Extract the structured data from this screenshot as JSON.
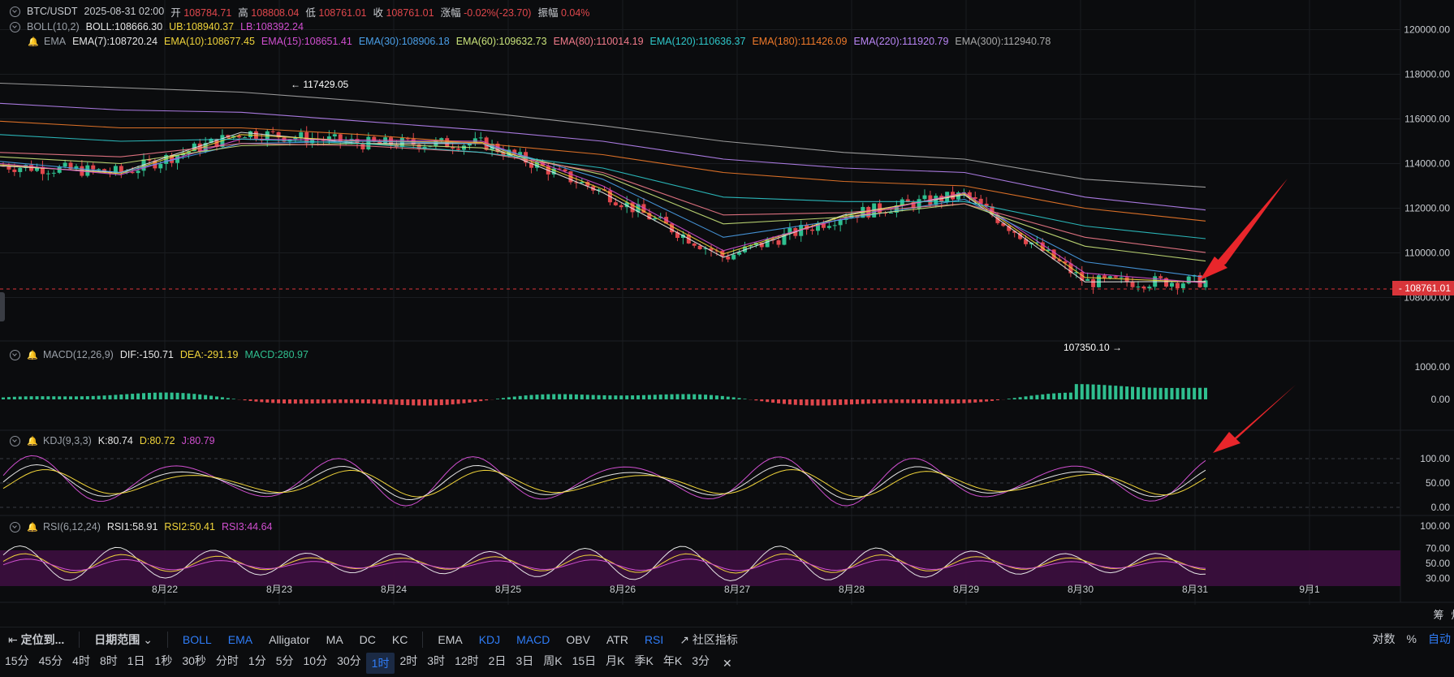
{
  "header": {
    "symbol_line": {
      "symbol": "BTC/USDT",
      "datetime": "2025-08-31 02:00",
      "open_label": "开",
      "open": "108784.71",
      "high_label": "高",
      "high": "108808.04",
      "low_label": "低",
      "low": "108761.01",
      "close_label": "收",
      "close": "108761.01",
      "change_label": "涨幅",
      "change": "-0.02%(-23.70)",
      "amplitude_label": "振幅",
      "amplitude": "0.04%"
    },
    "boll_line": {
      "name": "BOLL(10,2)",
      "mid": "BOLL:108666.30",
      "ub": "UB:108940.37",
      "lb": "LB:108392.24"
    },
    "ema_line": {
      "name": "EMA",
      "items": [
        {
          "text": "EMA(7):108720.24",
          "color": "#e6e6e6"
        },
        {
          "text": "EMA(10):108677.45",
          "color": "#f0d43a"
        },
        {
          "text": "EMA(15):108651.41",
          "color": "#d04fd0"
        },
        {
          "text": "EMA(30):108906.18",
          "color": "#4a9fe8"
        },
        {
          "text": "EMA(60):109632.73",
          "color": "#c9e37a"
        },
        {
          "text": "EMA(80):110014.19",
          "color": "#f07a8a"
        },
        {
          "text": "EMA(120):110636.37",
          "color": "#2ec7c9"
        },
        {
          "text": "EMA(180):111426.09",
          "color": "#f07a2a"
        },
        {
          "text": "EMA(220):111920.79",
          "color": "#b985f5"
        },
        {
          "text": "EMA(300):112940.78",
          "color": "#a8a8a8"
        }
      ]
    },
    "macd_line": {
      "name": "MACD(12,26,9)",
      "dif": "DIF:-150.71",
      "dea": "DEA:-291.19",
      "macd": "MACD:280.97"
    },
    "kdj_line": {
      "name": "KDJ(9,3,3)",
      "k": "K:80.74",
      "d": "D:80.72",
      "j": "J:80.79"
    },
    "rsi_line": {
      "name": "RSI(6,12,24)",
      "r1": "RSI1:58.91",
      "r2": "RSI2:50.41",
      "r3": "RSI3:44.64"
    }
  },
  "price_tag": "108761.01",
  "annotations": {
    "high_marker": "117429.05",
    "low_marker": "107350.10"
  },
  "chart_data": {
    "type": "line",
    "candlestick": true,
    "x": [
      "8月22",
      "8月23",
      "8月24",
      "8月25",
      "8月26",
      "8月27",
      "8月28",
      "8月29",
      "8月30",
      "8月31",
      "9月1"
    ],
    "price_ticks": [
      108000,
      110000,
      112000,
      114000,
      116000,
      118000,
      120000
    ],
    "price_range": [
      106600,
      120600
    ],
    "current_price": 108761.01,
    "series": [
      {
        "name": "EMA(7)",
        "color": "#e6e6e6",
        "values": [
          113900,
          113600,
          115400,
          114900,
          114900,
          112700,
          109800,
          111700,
          112600,
          108700,
          108720
        ]
      },
      {
        "name": "EMA(10)",
        "color": "#f0d43a",
        "values": [
          113950,
          113550,
          115300,
          115000,
          114950,
          112850,
          109950,
          111650,
          112650,
          108900,
          108677
        ]
      },
      {
        "name": "EMA(15)",
        "color": "#d04fd0",
        "values": [
          114000,
          113500,
          115100,
          115050,
          115000,
          113000,
          110100,
          111550,
          112700,
          109100,
          108651
        ]
      },
      {
        "name": "EMA(30)",
        "color": "#4a9fe8",
        "values": [
          114100,
          113600,
          114900,
          115000,
          114900,
          113300,
          110700,
          111500,
          112400,
          109600,
          108906
        ]
      },
      {
        "name": "EMA(60)",
        "color": "#c9e37a",
        "values": [
          114300,
          114000,
          114800,
          114900,
          114700,
          113500,
          111300,
          111600,
          112200,
          110300,
          109633
        ]
      },
      {
        "name": "EMA(80)",
        "color": "#f07a8a",
        "values": [
          114500,
          114300,
          114900,
          114800,
          114500,
          113600,
          111700,
          111800,
          112200,
          110700,
          110014
        ]
      },
      {
        "name": "EMA(120)",
        "color": "#2ec7c9",
        "values": [
          115300,
          115000,
          115100,
          114900,
          114500,
          113800,
          112500,
          112300,
          112300,
          111200,
          110636
        ]
      },
      {
        "name": "EMA(180)",
        "color": "#f07a2a",
        "values": [
          115900,
          115600,
          115600,
          115300,
          114900,
          114400,
          113600,
          113200,
          113000,
          112000,
          111426
        ]
      },
      {
        "name": "EMA(220)",
        "color": "#b985f5",
        "values": [
          116700,
          116400,
          116300,
          115900,
          115500,
          115000,
          114200,
          113800,
          113600,
          112500,
          111921
        ]
      },
      {
        "name": "EMA(300)",
        "color": "#a8a8a8",
        "values": [
          117600,
          117400,
          117200,
          116800,
          116300,
          115700,
          115000,
          114500,
          114200,
          113300,
          112941
        ]
      }
    ],
    "high": 117429.05,
    "low": 107350.1,
    "macd": {
      "ticks": [
        1000,
        0
      ],
      "dif": -150.71,
      "dea": -291.19,
      "macd": 280.97
    },
    "kdj": {
      "ticks": [
        100,
        50,
        0
      ],
      "k": 80.74,
      "d": 80.72,
      "j": 80.79
    },
    "rsi": {
      "ticks": [
        100,
        70,
        50,
        30
      ],
      "rsi1": 58.91,
      "rsi2": 50.41,
      "rsi3": 44.64
    }
  },
  "toolbar1": {
    "locate": "定位到...",
    "date_range": "日期范围",
    "main_indicators": [
      "BOLL",
      "EMA",
      "Alligator",
      "MA",
      "DC",
      "KC"
    ],
    "sub_indicators": [
      "EMA",
      "KDJ",
      "MACD",
      "OBV",
      "ATR",
      "RSI"
    ],
    "community": "社区指标",
    "right": [
      "对数",
      "%",
      "自动"
    ]
  },
  "toolbar2": {
    "intervals": [
      "15分",
      "45分",
      "4时",
      "8时",
      "1日",
      "1秒",
      "30秒",
      "分时",
      "1分",
      "5分",
      "10分",
      "30分",
      "1时",
      "2时",
      "3时",
      "12时",
      "2日",
      "3日",
      "周K",
      "15日",
      "月K",
      "季K",
      "年K",
      "3分"
    ],
    "active": "1时",
    "close": "✕"
  },
  "right_labels": [
    "筹",
    "烟"
  ],
  "colors": {
    "up": "#2fbf8f",
    "down": "#e0474c",
    "bg": "#0b0c0e",
    "grid": "#1b1d21",
    "axis_text": "#c9ccd1"
  }
}
